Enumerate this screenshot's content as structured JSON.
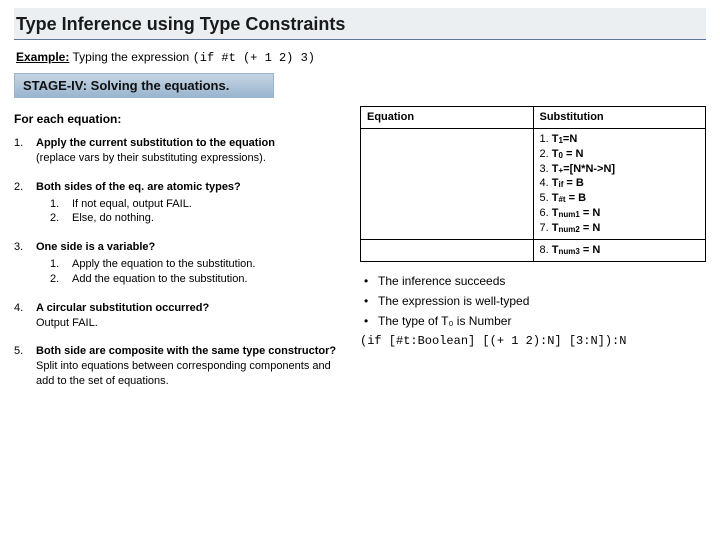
{
  "title": "Type Inference using Type Constraints",
  "example_label": "Example:",
  "example_text": "Typing the expression ",
  "example_code": "(if #t  (+ 1 2)  3)",
  "stage": "STAGE-IV: Solving the equations.",
  "foreach": "For each equation:",
  "steps": [
    {
      "n": "1.",
      "lead": "Apply the current substitution to the equation",
      "tail": "(replace vars by their substituting expressions).",
      "sub": []
    },
    {
      "n": "2.",
      "lead": "Both sides of the eq. are atomic types?",
      "tail": "",
      "sub": [
        {
          "sn": "1.",
          "t": "If not equal, output FAIL."
        },
        {
          "sn": "2.",
          "t": "Else, do nothing."
        }
      ]
    },
    {
      "n": "3.",
      "lead": "One side is a variable?",
      "tail": "",
      "sub": [
        {
          "sn": "1.",
          "t": "Apply the equation to the substitution."
        },
        {
          "sn": "2.",
          "t": "Add the equation to the substitution."
        }
      ]
    },
    {
      "n": "4.",
      "lead": "A circular substitution occurred?",
      "tail": "Output FAIL.",
      "sub": []
    },
    {
      "n": "5.",
      "lead": "Both side are composite with the same type constructor?",
      "tail": "Split into equations between corresponding components and add to the set of equations.",
      "sub": []
    }
  ],
  "table": {
    "h1": "Equation",
    "h2": "Substitution",
    "rows": [
      {
        "eq": "",
        "subs": [
          {
            "n": "1.",
            "pre": "T",
            "sub": "1",
            "post": "=N"
          },
          {
            "n": "2.",
            "pre": "T",
            "sub": "0",
            "post": " = N"
          },
          {
            "n": "3.",
            "pre": "T",
            "sub": "+",
            "post": "=[N*N->N]"
          },
          {
            "n": "4.",
            "pre": "T",
            "sub": "if",
            "post": " = B"
          },
          {
            "n": "5.",
            "pre": "T",
            "sub": "#t",
            "post": " = B"
          },
          {
            "n": "6.",
            "pre": "T",
            "sub": "num1",
            "post": " = N"
          },
          {
            "n": "7.",
            "pre": "T",
            "sub": "num2",
            "post": " = N"
          }
        ]
      },
      {
        "eq": "",
        "subs": [
          {
            "n": "8.",
            "pre": "T",
            "sub": "num3",
            "post": " = N"
          }
        ]
      }
    ]
  },
  "bullets": [
    "The inference succeeds",
    "The expression is well-typed",
    "The type of T₀ is Number"
  ],
  "final": "(if [#t:Boolean] [(+ 1 2):N] [3:N]):N"
}
